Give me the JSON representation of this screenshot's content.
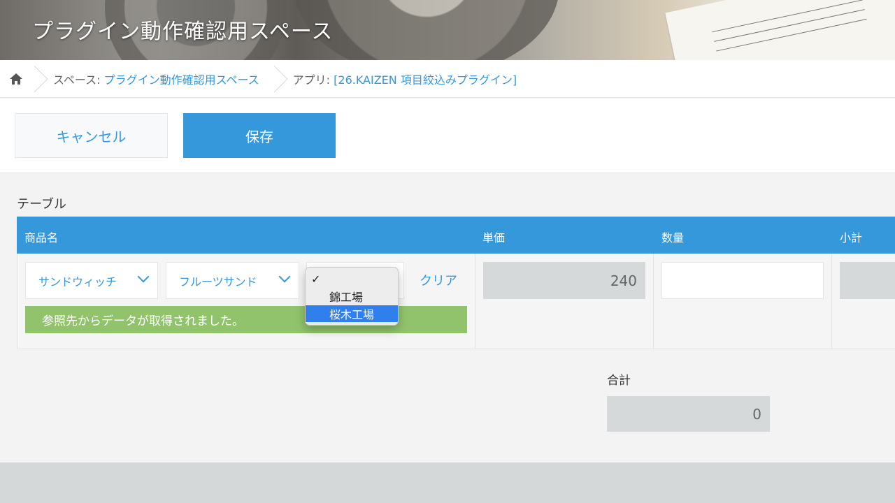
{
  "header": {
    "title": "プラグイン動作確認用スペース"
  },
  "breadcrumb": {
    "space_prefix": "スペース: ",
    "space_name": "プラグイン動作確認用スペース",
    "app_prefix": "アプリ: ",
    "app_name": "[26.KAIZEN 項目絞込みプラグイン]"
  },
  "toolbar": {
    "cancel_label": "キャンセル",
    "save_label": "保存"
  },
  "form": {
    "section_label": "テーブル",
    "columns": [
      "商品名",
      "単価",
      "数量",
      "小計"
    ],
    "row": {
      "select1": "サンドウィッチ",
      "select2": "フルーツサンド",
      "clear_label": "クリア",
      "message": "参照先からデータが取得されました。",
      "unit_price": "240",
      "quantity": "",
      "subtotal": ""
    },
    "dropdown": {
      "check_mark": "✓",
      "options": [
        "",
        "錦工場",
        "桜木工場"
      ],
      "highlighted": "桜木工場"
    },
    "total_label": "合計",
    "total_value": "0"
  },
  "colors": {
    "accent": "#3498db",
    "success": "#91c36c",
    "readonly": "#d6d9da"
  }
}
